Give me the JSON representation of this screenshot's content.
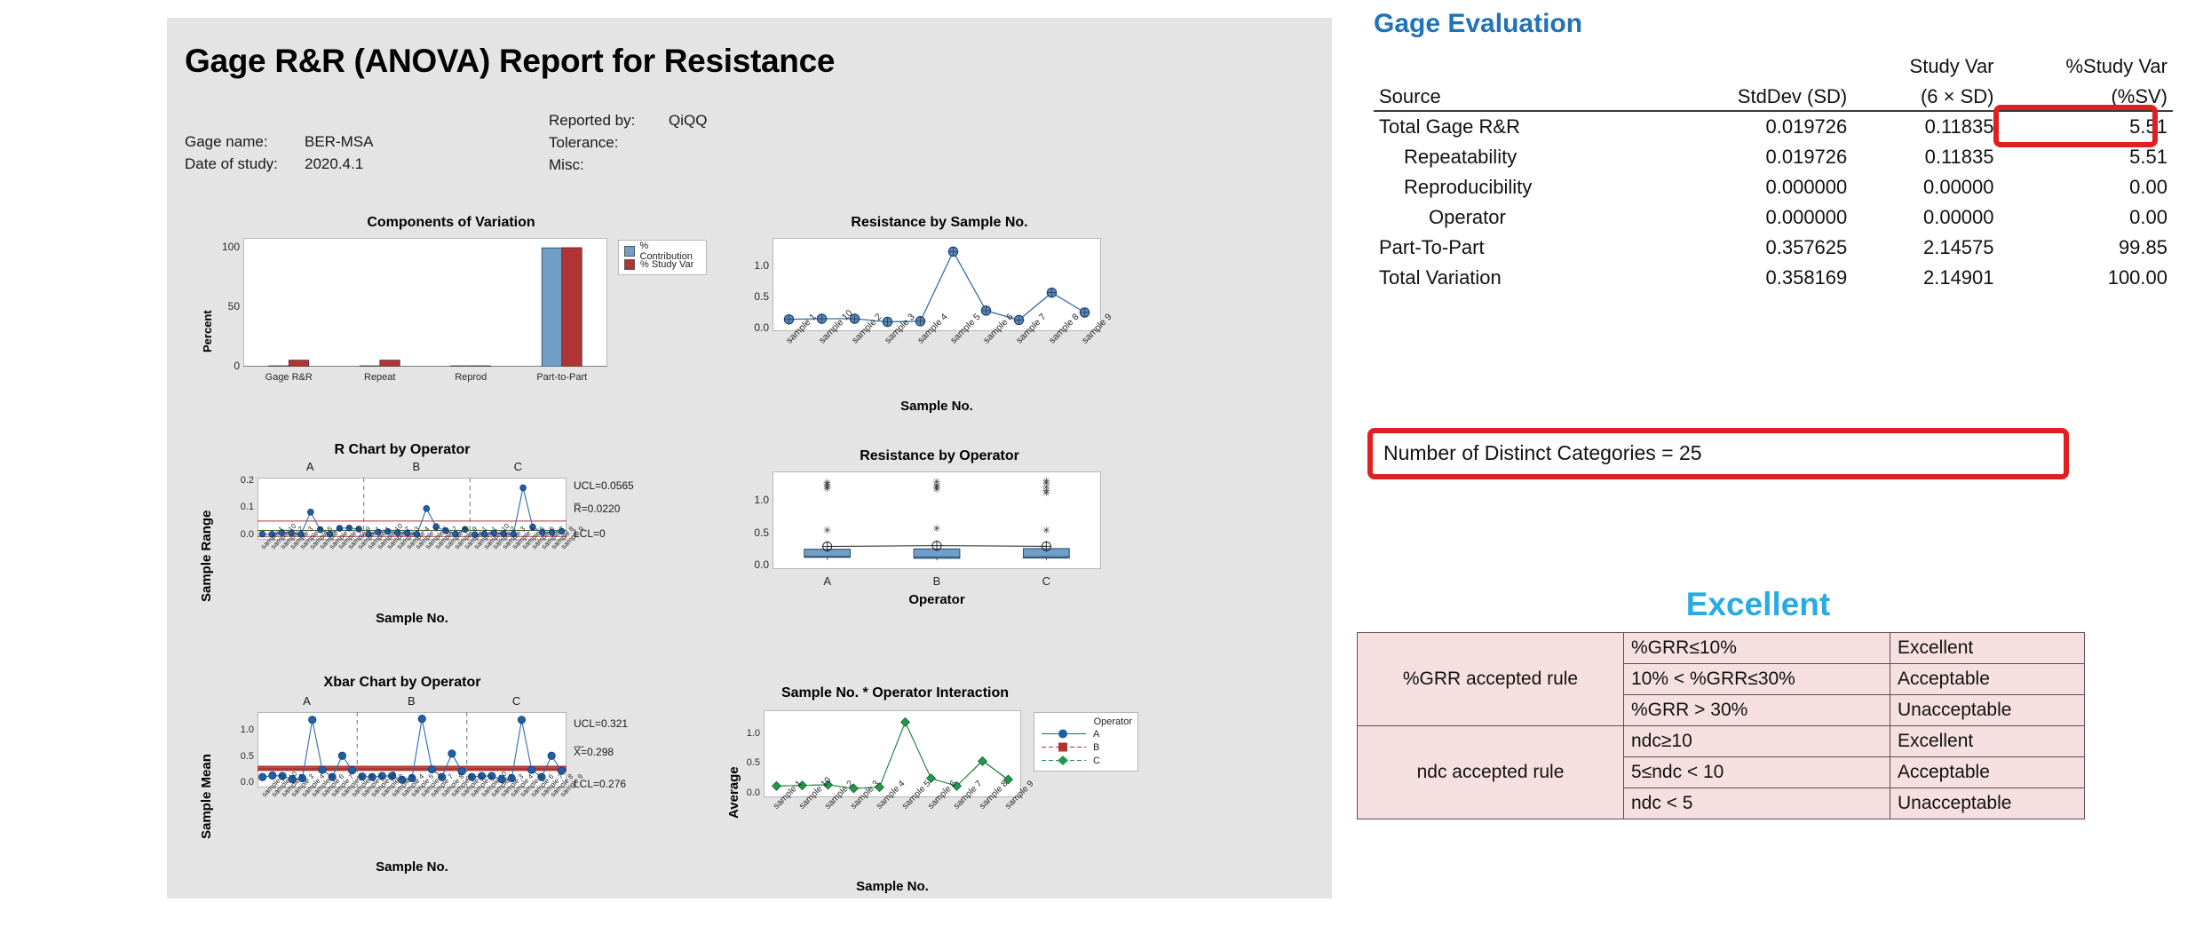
{
  "report": {
    "title": "Gage R&R (ANOVA) Report for Resistance",
    "fields_left": [
      {
        "label": "Gage name:",
        "value": "BER-MSA"
      },
      {
        "label": "Date of study:",
        "value": "2020.4.1"
      }
    ],
    "fields_right": [
      {
        "label": "Reported by:",
        "value": "QiQQ"
      },
      {
        "label": "Tolerance:",
        "value": ""
      },
      {
        "label": "Misc:",
        "value": ""
      }
    ]
  },
  "gage_evaluation": {
    "heading": "Gage Evaluation",
    "super_headers": [
      "Study Var",
      "%Study Var"
    ],
    "columns": [
      "Source",
      "StdDev (SD)",
      "(6 × SD)",
      "(%SV)"
    ],
    "rows": [
      {
        "source": "Total Gage R&R",
        "indent": 0,
        "sd": "0.019726",
        "studyvar": "0.11835",
        "pct": "5.51"
      },
      {
        "source": "Repeatability",
        "indent": 1,
        "sd": "0.019726",
        "studyvar": "0.11835",
        "pct": "5.51"
      },
      {
        "source": "Reproducibility",
        "indent": 1,
        "sd": "0.000000",
        "studyvar": "0.00000",
        "pct": "0.00"
      },
      {
        "source": "Operator",
        "indent": 2,
        "sd": "0.000000",
        "studyvar": "0.00000",
        "pct": "0.00"
      },
      {
        "source": "Part-To-Part",
        "indent": 0,
        "sd": "0.357625",
        "studyvar": "2.14575",
        "pct": "99.85"
      },
      {
        "source": "Total Variation",
        "indent": 0,
        "sd": "0.358169",
        "studyvar": "2.14901",
        "pct": "100.00"
      }
    ],
    "ndc_text": "Number of Distinct Categories = 25",
    "highlight_color": "#e02020"
  },
  "verdict": {
    "label": "Excellent",
    "color": "#29abe2"
  },
  "acceptance_rules": {
    "groups": [
      {
        "name": "%GRR accepted rule",
        "rows": [
          {
            "condition": "%GRR≤10%",
            "result": "Excellent"
          },
          {
            "condition": "10% < %GRR≤30%",
            "result": "Acceptable"
          },
          {
            "condition": "%GRR > 30%",
            "result": "Unacceptable"
          }
        ]
      },
      {
        "name": "ndc accepted rule",
        "rows": [
          {
            "condition": "ndc≥10",
            "result": "Excellent"
          },
          {
            "condition": "5≤ndc < 10",
            "result": "Acceptable"
          },
          {
            "condition": "ndc < 5",
            "result": "Unacceptable"
          }
        ]
      }
    ]
  },
  "chart_data": [
    {
      "type": "bar",
      "id": "components-of-variation",
      "title": "Components of Variation",
      "xlabel": "",
      "ylabel": "Percent",
      "ylim": [
        0,
        108
      ],
      "yticks": [
        0,
        50,
        100
      ],
      "categories": [
        "Gage R&R",
        "Repeat",
        "Reprod",
        "Part-to-Part"
      ],
      "series": [
        {
          "name": "% Contribution",
          "color": "#6f9fc8",
          "values": [
            0.3,
            0.3,
            0.0,
            99.7
          ]
        },
        {
          "name": "% Study Var",
          "color": "#b03434",
          "values": [
            5.51,
            5.51,
            0.0,
            99.85
          ]
        }
      ],
      "legend_position": "right",
      "grid": false
    },
    {
      "type": "line",
      "id": "resistance-by-sample-no",
      "title": "Resistance by Sample No.",
      "xlabel": "Sample No.",
      "ylabel": "",
      "ylim": [
        -0.05,
        1.45
      ],
      "yticks": [
        0.0,
        0.5,
        1.0
      ],
      "ytick_labels": [
        "0.0",
        "0.5",
        "1.0"
      ],
      "categories": [
        "sample 1",
        "sample 10",
        "sample 2",
        "sample 3",
        "sample 4",
        "sample 5",
        "sample 6",
        "sample 7",
        "sample 8",
        "sample 9"
      ],
      "series": [
        {
          "name": "Resistance",
          "color": "#3a6ea5",
          "values": [
            0.14,
            0.15,
            0.15,
            0.1,
            0.11,
            1.23,
            0.28,
            0.13,
            0.57,
            0.25
          ]
        }
      ],
      "grid": false
    },
    {
      "type": "line",
      "id": "r-chart-by-operator",
      "title": "R Chart by Operator",
      "xlabel": "Sample No.",
      "ylabel": "Sample Range",
      "ylim": [
        -0.012,
        0.215
      ],
      "yticks": [
        0.0,
        0.1,
        0.2
      ],
      "ytick_labels": [
        "0.0",
        "0.1",
        "0.2"
      ],
      "panels": [
        "A",
        "B",
        "C"
      ],
      "categories": [
        "sample 1",
        "sample 10",
        "sample 2",
        "sample 3",
        "sample 4",
        "sample 5",
        "sample 6",
        "sample 7",
        "sample 8",
        "sample 9"
      ],
      "control_limits": [
        {
          "label": "UCL=0.0565",
          "value": 0.0565,
          "color": "#b03434"
        },
        {
          "label": "R̅=0.0220",
          "value": 0.022,
          "color": "#3c6b2f"
        },
        {
          "label": "LCL=0",
          "value": 0.0,
          "color": "#b03434"
        }
      ],
      "series": [
        {
          "name": "A",
          "color": "#1f5fa8",
          "values": [
            0.009,
            0.008,
            0.014,
            0.013,
            0.008,
            0.089,
            0.025,
            0.009,
            0.03,
            0.031,
            0.027
          ]
        },
        {
          "name": "B",
          "color": "#1f5fa8",
          "values": [
            0.009,
            0.016,
            0.018,
            0.014,
            0.013,
            0.008,
            0.102,
            0.036,
            0.021,
            0.009,
            0.026
          ]
        },
        {
          "name": "C",
          "color": "#1f5fa8",
          "values": [
            0.007,
            0.009,
            0.013,
            0.01,
            0.009,
            0.178,
            0.035,
            0.015,
            0.015,
            0.019
          ]
        }
      ],
      "grid": false
    },
    {
      "type": "boxplot",
      "id": "resistance-by-operator",
      "title": "Resistance by Operator",
      "xlabel": "Operator",
      "ylabel": "",
      "ylim": [
        -0.05,
        1.45
      ],
      "yticks": [
        0.0,
        0.5,
        1.0
      ],
      "ytick_labels": [
        "0.0",
        "0.5",
        "1.0"
      ],
      "categories": [
        "A",
        "B",
        "C"
      ],
      "boxes": [
        {
          "category": "A",
          "q1": 0.13,
          "median": 0.145,
          "q3": 0.255,
          "whisker_low": 0.09,
          "whisker_high": 0.255,
          "mean": 0.298,
          "outliers": [
            0.55,
            1.19,
            1.22,
            1.25,
            1.28
          ]
        },
        {
          "category": "B",
          "q1": 0.115,
          "median": 0.135,
          "q3": 0.26,
          "whisker_low": 0.085,
          "whisker_high": 0.26,
          "mean": 0.31,
          "outliers": [
            0.58,
            1.18,
            1.21,
            1.24,
            1.29
          ]
        },
        {
          "category": "C",
          "q1": 0.12,
          "median": 0.14,
          "q3": 0.265,
          "whisker_low": 0.085,
          "whisker_high": 0.265,
          "mean": 0.3,
          "outliers": [
            0.55,
            1.12,
            1.16,
            1.21,
            1.27,
            1.31
          ]
        }
      ],
      "box_color": "#6f9fc8",
      "grid": false
    },
    {
      "type": "line",
      "id": "xbar-chart-by-operator",
      "title": "Xbar Chart by Operator",
      "xlabel": "Sample No.",
      "ylabel": "Sample Mean",
      "ylim": [
        -0.07,
        1.38
      ],
      "yticks": [
        0.0,
        0.5,
        1.0
      ],
      "ytick_labels": [
        "0.0",
        "0.5",
        "1.0"
      ],
      "panels": [
        "A",
        "B",
        "C"
      ],
      "categories": [
        "sample 1",
        "sample 10",
        "sample 2",
        "sample 3",
        "sample 4",
        "sample 5",
        "sample 6",
        "sample 7",
        "sample 8",
        "sample 9"
      ],
      "control_limits": [
        {
          "label": "UCL=0.321",
          "value": 0.321,
          "color": "#b03434"
        },
        {
          "label": "X̅̅=0.298",
          "value": 0.298,
          "color": "#8a6a3a"
        },
        {
          "label": "LCL=0.276",
          "value": 0.276,
          "color": "#b03434"
        }
      ],
      "series": [
        {
          "name": "A",
          "color": "#1f5fa8",
          "values": [
            0.13,
            0.16,
            0.15,
            0.09,
            0.11,
            1.23,
            0.27,
            0.13,
            0.54,
            0.26
          ]
        },
        {
          "name": "B",
          "color": "#1f5fa8",
          "values": [
            0.14,
            0.13,
            0.15,
            0.15,
            0.08,
            0.11,
            1.25,
            0.28,
            0.13,
            0.58,
            0.24
          ]
        },
        {
          "name": "C",
          "color": "#1f5fa8",
          "values": [
            0.13,
            0.15,
            0.15,
            0.09,
            0.11,
            1.23,
            0.27,
            0.13,
            0.54,
            0.25
          ]
        }
      ],
      "grid": false
    },
    {
      "type": "line",
      "id": "sample-operator-interaction",
      "title": "Sample No. * Operator Interaction",
      "xlabel": "Sample No.",
      "ylabel": "Average",
      "ylim": [
        -0.05,
        1.42
      ],
      "yticks": [
        0.0,
        0.5,
        1.0
      ],
      "ytick_labels": [
        "0.0",
        "0.5",
        "1.0"
      ],
      "categories": [
        "sample 1",
        "sample 10",
        "sample 2",
        "sample 3",
        "sample 4",
        "sample 5",
        "sample 6",
        "sample 7",
        "sample 8",
        "sample 9"
      ],
      "legend_title": "Operator",
      "legend_position": "right",
      "series": [
        {
          "name": "A",
          "color": "#1f5fa8",
          "marker": "circle",
          "values": [
            0.14,
            0.15,
            0.16,
            0.1,
            0.12,
            1.22,
            0.27,
            0.14,
            0.57,
            0.25
          ]
        },
        {
          "name": "B",
          "color": "#b03434",
          "marker": "square",
          "values": [
            0.14,
            0.15,
            0.16,
            0.1,
            0.12,
            1.22,
            0.27,
            0.14,
            0.57,
            0.24
          ]
        },
        {
          "name": "C",
          "color": "#1f9a4a",
          "marker": "diamond",
          "values": [
            0.14,
            0.15,
            0.16,
            0.1,
            0.12,
            1.22,
            0.27,
            0.14,
            0.56,
            0.25
          ]
        }
      ],
      "grid": false
    }
  ]
}
